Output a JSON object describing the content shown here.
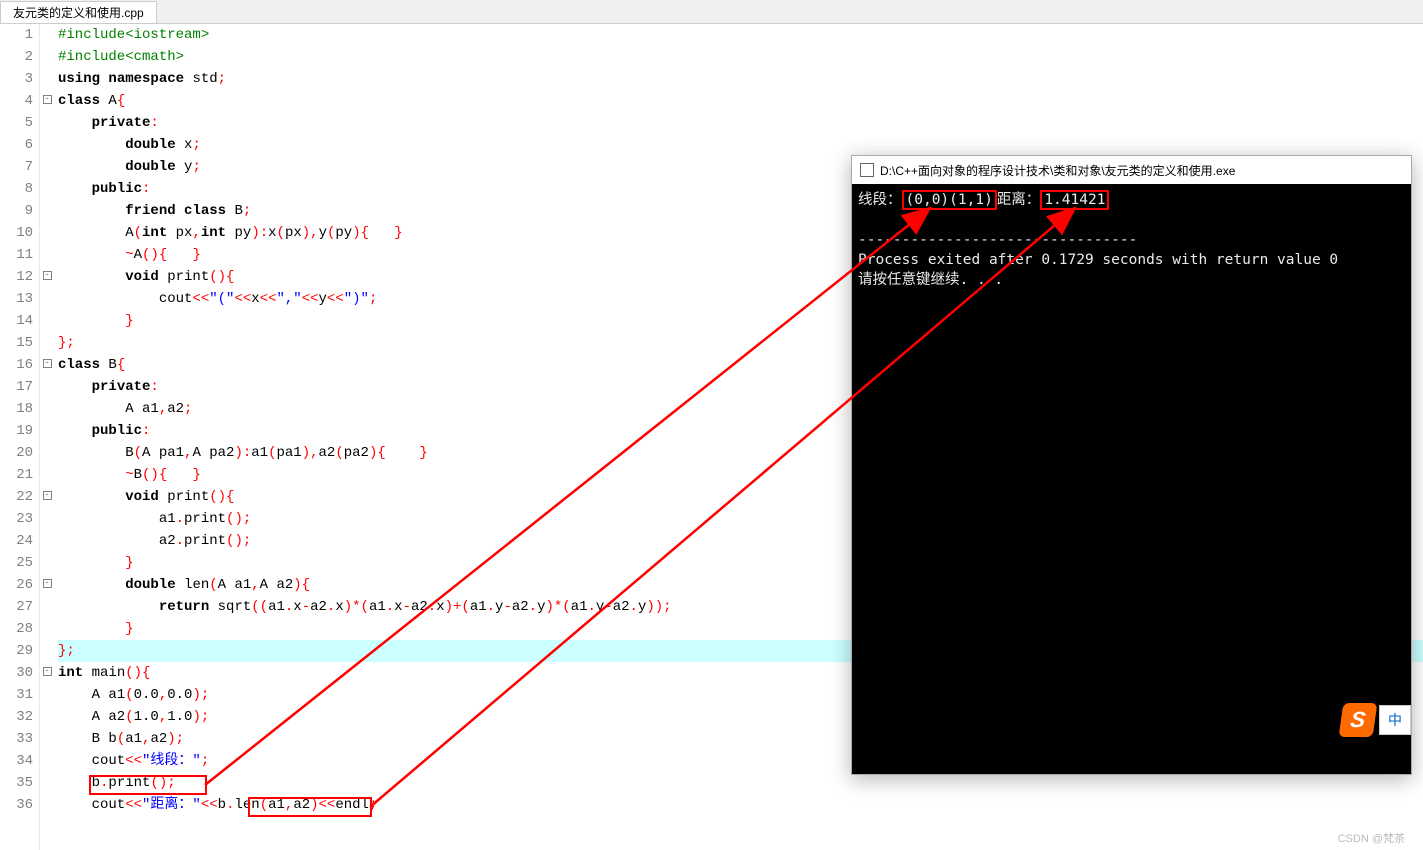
{
  "tab": {
    "title": "友元类的定义和使用.cpp"
  },
  "code": {
    "lines": [
      {
        "n": 1,
        "f": "",
        "html": "<span class='pp'>#include&lt;iostream&gt;</span>"
      },
      {
        "n": 2,
        "f": "",
        "html": "<span class='pp'>#include&lt;cmath&gt;</span>"
      },
      {
        "n": 3,
        "f": "",
        "html": "<span class='kw'>using</span> <span class='kw'>namespace</span> std<span class='op'>;</span>"
      },
      {
        "n": 4,
        "f": "box",
        "html": "<span class='kw'>class</span> A<span class='op'>{</span>"
      },
      {
        "n": 5,
        "f": "",
        "html": "    <span class='kw'>private</span><span class='op'>:</span>"
      },
      {
        "n": 6,
        "f": "",
        "html": "        <span class='kw'>double</span> x<span class='op'>;</span>"
      },
      {
        "n": 7,
        "f": "",
        "html": "        <span class='kw'>double</span> y<span class='op'>;</span>"
      },
      {
        "n": 8,
        "f": "",
        "html": "    <span class='kw'>public</span><span class='op'>:</span>"
      },
      {
        "n": 9,
        "f": "",
        "html": "        <span class='kw'>friend</span> <span class='kw'>class</span> B<span class='op'>;</span>"
      },
      {
        "n": 10,
        "f": "",
        "html": "        A<span class='op'>(</span><span class='kw'>int</span> px<span class='op'>,</span><span class='kw'>int</span> py<span class='op'>):</span>x<span class='op'>(</span>px<span class='op'>),</span>y<span class='op'>(</span>py<span class='op'>){</span>   <span class='op'>}</span>"
      },
      {
        "n": 11,
        "f": "",
        "html": "        <span class='op'>~</span>A<span class='op'>(){</span>   <span class='op'>}</span>"
      },
      {
        "n": 12,
        "f": "box",
        "html": "        <span class='kw'>void</span> print<span class='op'>(){</span>"
      },
      {
        "n": 13,
        "f": "",
        "html": "            cout<span class='op'>&lt;&lt;</span><span class='str'>\"(\"</span><span class='op'>&lt;&lt;</span>x<span class='op'>&lt;&lt;</span><span class='str'>\",\"</span><span class='op'>&lt;&lt;</span>y<span class='op'>&lt;&lt;</span><span class='str'>\")\"</span><span class='op'>;</span>"
      },
      {
        "n": 14,
        "f": "",
        "html": "        <span class='op'>}</span>"
      },
      {
        "n": 15,
        "f": "",
        "html": "<span class='op'>};</span>"
      },
      {
        "n": 16,
        "f": "box",
        "html": "<span class='kw'>class</span> B<span class='op'>{</span>"
      },
      {
        "n": 17,
        "f": "",
        "html": "    <span class='kw'>private</span><span class='op'>:</span>"
      },
      {
        "n": 18,
        "f": "",
        "html": "        A a1<span class='op'>,</span>a2<span class='op'>;</span>"
      },
      {
        "n": 19,
        "f": "",
        "html": "    <span class='kw'>public</span><span class='op'>:</span>"
      },
      {
        "n": 20,
        "f": "",
        "html": "        B<span class='op'>(</span>A pa1<span class='op'>,</span>A pa2<span class='op'>):</span>a1<span class='op'>(</span>pa1<span class='op'>),</span>a2<span class='op'>(</span>pa2<span class='op'>){</span>    <span class='op'>}</span>"
      },
      {
        "n": 21,
        "f": "",
        "html": "        <span class='op'>~</span>B<span class='op'>(){</span>   <span class='op'>}</span>"
      },
      {
        "n": 22,
        "f": "box",
        "html": "        <span class='kw'>void</span> print<span class='op'>(){</span>"
      },
      {
        "n": 23,
        "f": "",
        "html": "            a1<span class='op'>.</span>print<span class='op'>();</span>"
      },
      {
        "n": 24,
        "f": "",
        "html": "            a2<span class='op'>.</span>print<span class='op'>();</span>"
      },
      {
        "n": 25,
        "f": "",
        "html": "        <span class='op'>}</span>"
      },
      {
        "n": 26,
        "f": "box",
        "html": "        <span class='kw'>double</span> len<span class='op'>(</span>A a1<span class='op'>,</span>A a2<span class='op'>){</span>"
      },
      {
        "n": 27,
        "f": "",
        "html": "            <span class='kw'>return</span> sqrt<span class='op'>((</span>a1<span class='op'>.</span>x<span class='op'>-</span>a2<span class='op'>.</span>x<span class='op'>)*(</span>a1<span class='op'>.</span>x<span class='op'>-</span>a2<span class='op'>.</span>x<span class='op'>)+(</span>a1<span class='op'>.</span>y<span class='op'>-</span>a2<span class='op'>.</span>y<span class='op'>)*(</span>a1<span class='op'>.</span>y<span class='op'>-</span>a2<span class='op'>.</span>y<span class='op'>));</span>"
      },
      {
        "n": 28,
        "f": "",
        "html": "        <span class='op'>}</span>"
      },
      {
        "n": 29,
        "f": "",
        "hl": true,
        "html": "<span class='op'>};</span>"
      },
      {
        "n": 30,
        "f": "box",
        "html": "<span class='kw'>int</span> main<span class='op'>(){</span>"
      },
      {
        "n": 31,
        "f": "",
        "html": "    A a1<span class='op'>(</span>0.0<span class='op'>,</span>0.0<span class='op'>);</span>"
      },
      {
        "n": 32,
        "f": "",
        "html": "    A a2<span class='op'>(</span>1.0<span class='op'>,</span>1.0<span class='op'>);</span>"
      },
      {
        "n": 33,
        "f": "",
        "html": "    B b<span class='op'>(</span>a1<span class='op'>,</span>a2<span class='op'>);</span>"
      },
      {
        "n": 34,
        "f": "",
        "html": "    cout<span class='op'>&lt;&lt;</span><span class='str'>\"线段：\"</span><span class='op'>;</span>"
      },
      {
        "n": 35,
        "f": "",
        "html": "    b<span class='op'>.</span>print<span class='op'>();</span>"
      },
      {
        "n": 36,
        "f": "",
        "html": "    cout<span class='op'>&lt;&lt;</span><span class='str'>\"距离：\"</span><span class='op'>&lt;&lt;</span>b<span class='op'>.</span>len<span class='op'>(</span>a1<span class='op'>,</span>a2<span class='op'>)&lt;&lt;</span>endl<span class='op'>;</span>"
      }
    ]
  },
  "console": {
    "title": "D:\\C++面向对象的程序设计技术\\类和对象\\友元类的定义和使用.exe",
    "output_label1": "线段：",
    "output_val1": "(0,0)(1,1)",
    "output_label2": "距离：",
    "output_val2": "1.41421",
    "sep": "--------------------------------",
    "exit_msg": "Process exited after 0.1729 seconds with return value 0",
    "press_msg": "请按任意键继续. . ."
  },
  "ime": {
    "logo": "S",
    "mode": "中"
  },
  "watermark": "CSDN @梵茶"
}
